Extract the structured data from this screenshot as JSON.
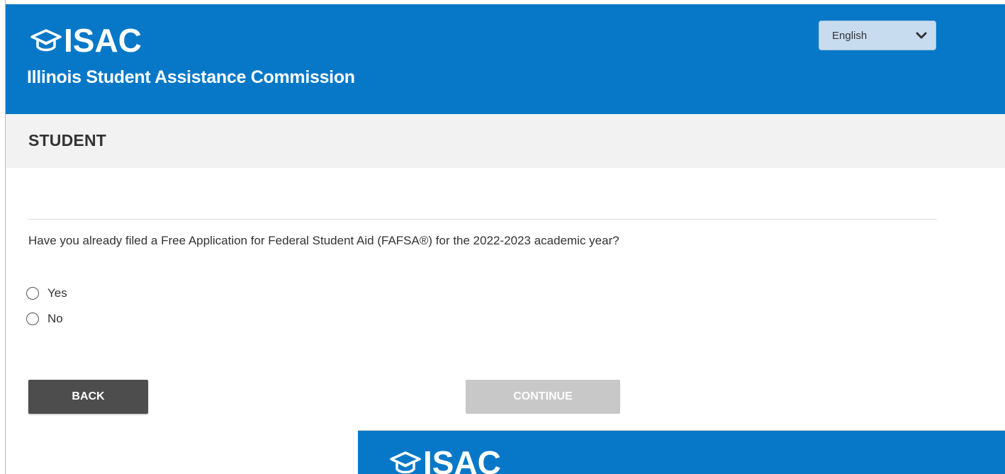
{
  "header": {
    "logo_text": "ISAC",
    "subtitle": "Illinois Student Assistance Commission",
    "language": {
      "selected": "English"
    }
  },
  "section": {
    "title": "STUDENT"
  },
  "form": {
    "question": "Have you already filed a Free Application for Federal Student Aid (FAFSA®) for the 2022-2023 academic year?",
    "options": [
      {
        "label": "Yes",
        "selected": false
      },
      {
        "label": "No",
        "selected": false
      }
    ]
  },
  "buttons": {
    "back_label": "BACK",
    "continue_label": "CONTINUE"
  },
  "overlay": {
    "logo_text": "ISAC"
  },
  "colors": {
    "brand_blue": "#0778c8",
    "band_gray": "#f2f2f2",
    "back_button": "#4d4d4d",
    "continue_disabled": "#c8c8c8"
  },
  "icons": {
    "logo": "graduation-cap-icon",
    "language_dropdown": "chevron-down-icon"
  }
}
